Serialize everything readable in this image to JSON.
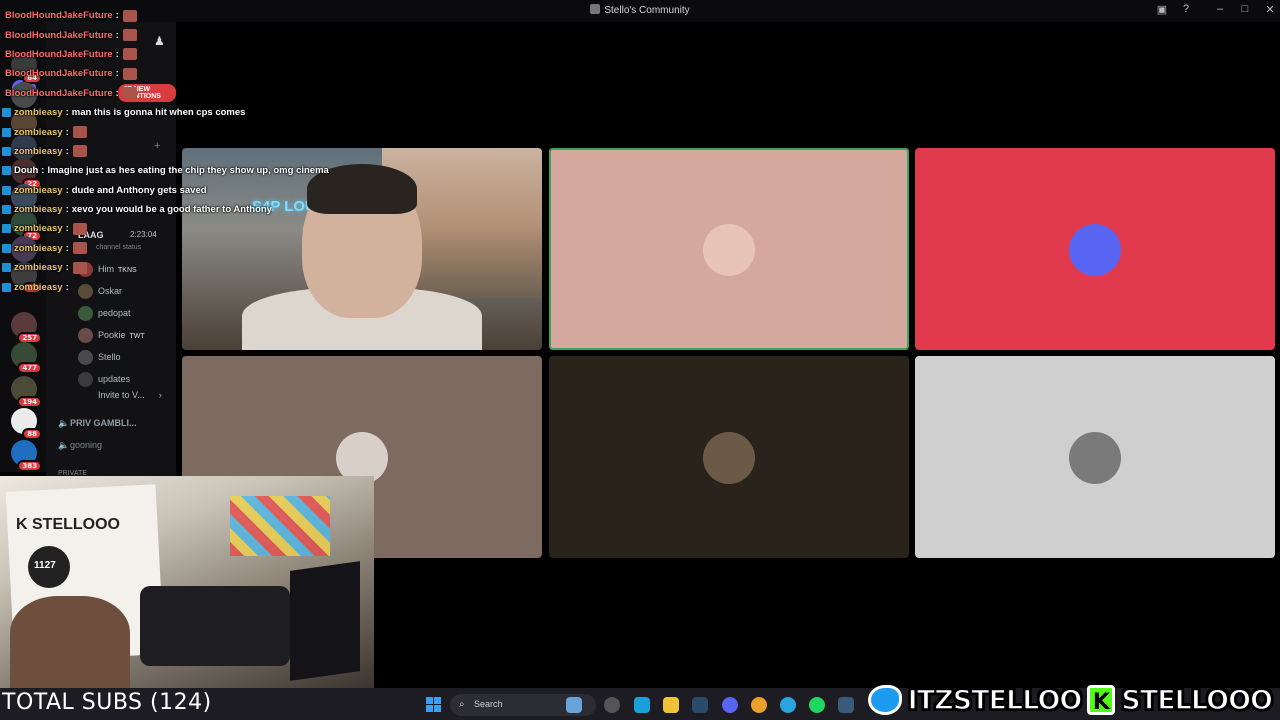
{
  "window": {
    "title": "Stello's Community"
  },
  "mentions_pill": "27 NEW MENTIONS",
  "servers": [
    {
      "badge": "64"
    },
    {
      "badge": ""
    },
    {
      "badge": ""
    },
    {
      "badge": ""
    },
    {
      "badge": "22"
    },
    {
      "badge": ""
    },
    {
      "badge": "72"
    },
    {
      "badge": ""
    },
    {
      "badge": "27"
    },
    {
      "badge": "257"
    },
    {
      "badge": "477"
    },
    {
      "badge": "194"
    },
    {
      "badge": "88"
    },
    {
      "badge": "383"
    }
  ],
  "voice": {
    "channel_status": "channel status",
    "timer": "2:23:04",
    "host_name": "LAAG",
    "members": [
      {
        "name": "Him",
        "tag": "TKNS"
      },
      {
        "name": "Oskar",
        "tag": ""
      },
      {
        "name": "pedopat",
        "tag": ""
      },
      {
        "name": "Pookie",
        "tag": "TWT"
      },
      {
        "name": "Stello",
        "tag": ""
      },
      {
        "name": "updates",
        "tag": ""
      }
    ],
    "invite": "Invite to V..."
  },
  "channels": {
    "gamble": "PRIV GAMBLI...",
    "gooning": "gooning",
    "private_header": "PRIVATE"
  },
  "chat": [
    {
      "user": "BloodHoundJakeFuture",
      "color": "red",
      "text": "",
      "emote": true
    },
    {
      "user": "BloodHoundJakeFuture",
      "color": "red",
      "text": "",
      "emote": true
    },
    {
      "user": "BloodHoundJakeFuture",
      "color": "red",
      "text": "",
      "emote": true
    },
    {
      "user": "BloodHoundJakeFuture",
      "color": "red",
      "text": "",
      "emote": true
    },
    {
      "user": "BloodHoundJakeFuture",
      "color": "red",
      "text": "",
      "emote": true
    },
    {
      "user": "zombieasy",
      "color": "gold",
      "text": "man this is gonna hit when cps comes",
      "emote": false
    },
    {
      "user": "zombieasy",
      "color": "gold",
      "text": "",
      "emote": true
    },
    {
      "user": "zombieasy",
      "color": "gold",
      "text": "",
      "emote": true
    },
    {
      "user": "Douh",
      "color": "white",
      "text": "Imagine just as hes eating the chip they show up, omg cinema",
      "emote": false
    },
    {
      "user": "zombieasy",
      "color": "gold",
      "text": "dude and Anthony gets saved",
      "emote": false
    },
    {
      "user": "zombieasy",
      "color": "gold",
      "text": "xevo you would be a good father to Anthony",
      "emote": false
    },
    {
      "user": "zombieasy",
      "color": "gold",
      "text": "",
      "emote": true
    },
    {
      "user": "zombieasy",
      "color": "gold",
      "text": "",
      "emote": true
    },
    {
      "user": "zombieasy",
      "color": "gold",
      "text": "",
      "emote": true
    },
    {
      "user": "zombieasy",
      "color": "gold",
      "text": "",
      "emote": false
    }
  ],
  "tiles": [
    {
      "kind": "camera",
      "bg": "#5f6f7a",
      "neon": "S4P LOUNGE"
    },
    {
      "kind": "avatar",
      "bg": "#d4a89c",
      "border": "#3ba55c"
    },
    {
      "kind": "avatar",
      "bg": "#e03a4c"
    },
    {
      "kind": "avatar",
      "bg": "#7d6a60"
    },
    {
      "kind": "avatar",
      "bg": "#2a231c"
    },
    {
      "kind": "avatar",
      "bg": "#cfcfcf"
    }
  ],
  "webcam": {
    "box_text": "K STELLOOO",
    "circle_text": "1127"
  },
  "overlay": {
    "total_subs": "TOTAL SUBS (124)"
  },
  "taskbar": {
    "search_placeholder": "Search"
  },
  "banner": {
    "twitter_handle": "ITZSTELLOO",
    "kick_handle": "STELLOOO",
    "kick_letter": "K"
  }
}
